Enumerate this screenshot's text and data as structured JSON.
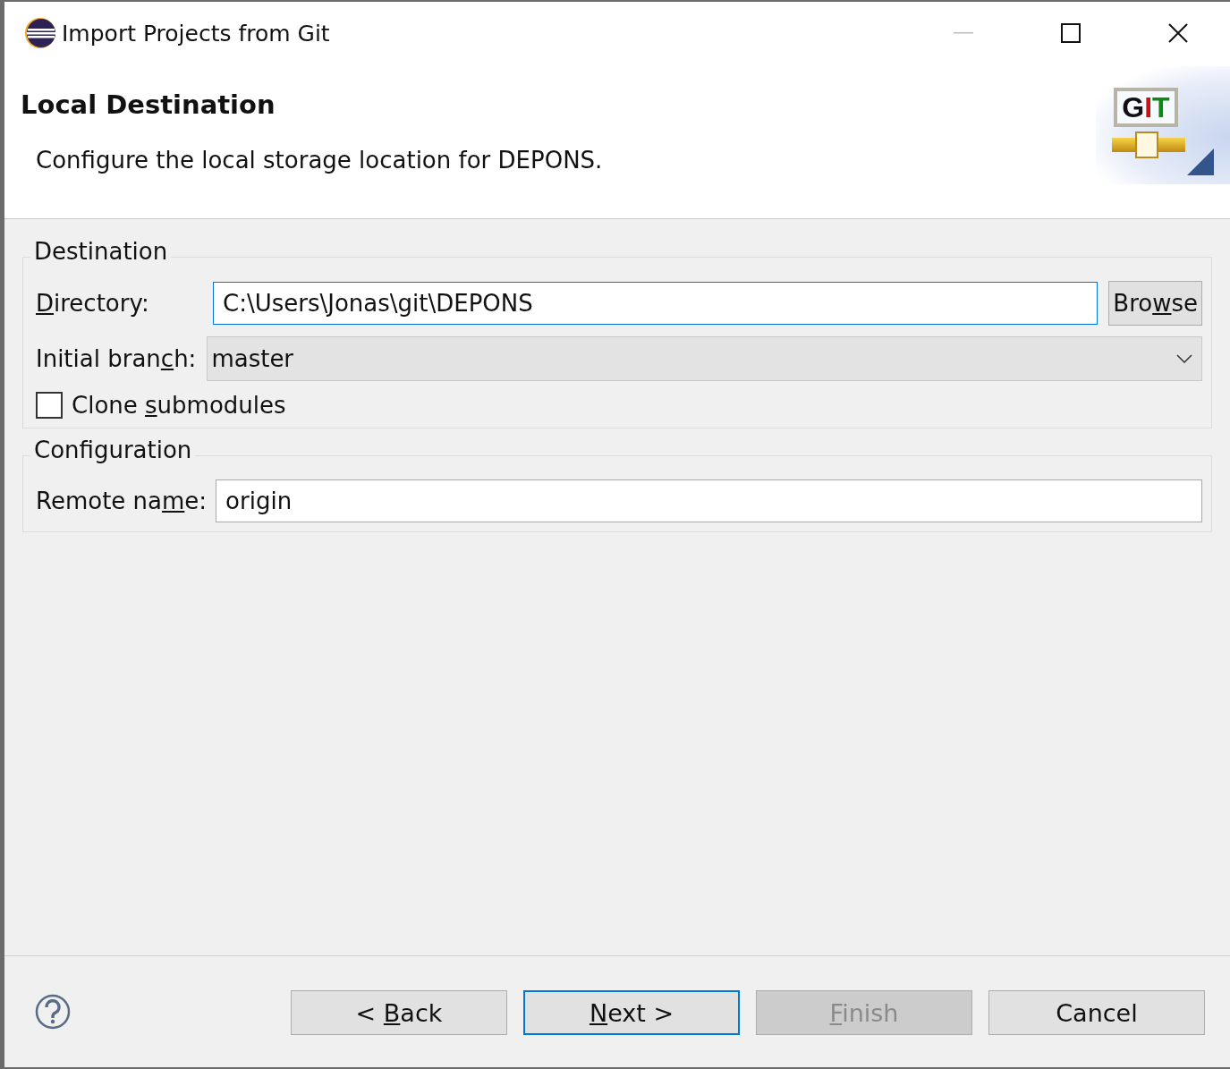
{
  "window": {
    "title": "Import Projects from Git"
  },
  "header": {
    "title": "Local Destination",
    "description": "Configure the local storage location for DEPONS.",
    "logo_letters": [
      {
        "text": "G",
        "color": "#111111"
      },
      {
        "text": "I",
        "color": "#cc1111"
      },
      {
        "text": "T",
        "color": "#118811"
      }
    ]
  },
  "destination": {
    "group_title": "Destination",
    "directory": {
      "label": [
        {
          "text": "D",
          "underlined": true
        },
        {
          "text": "irectory:",
          "underlined": false
        }
      ],
      "value": "C:\\Users\\Jonas\\git\\DEPONS",
      "focused": true
    },
    "browse": {
      "label": [
        {
          "text": "Bro",
          "underlined": false
        },
        {
          "text": "w",
          "underlined": true
        },
        {
          "text": "se",
          "underlined": false
        }
      ]
    },
    "initial_branch": {
      "label": [
        {
          "text": "Initial bran",
          "underlined": false
        },
        {
          "text": "c",
          "underlined": true
        },
        {
          "text": "h:",
          "underlined": false
        }
      ],
      "value": "master"
    },
    "clone_submodules": {
      "label": [
        {
          "text": "Clone ",
          "underlined": false
        },
        {
          "text": "s",
          "underlined": true
        },
        {
          "text": "ubmodules",
          "underlined": false
        }
      ],
      "checked": false
    }
  },
  "configuration": {
    "group_title": "Configuration",
    "remote_name": {
      "label": [
        {
          "text": "Remote na",
          "underlined": false
        },
        {
          "text": "m",
          "underlined": true
        },
        {
          "text": "e:",
          "underlined": false
        }
      ],
      "value": "origin"
    }
  },
  "buttons": [
    {
      "label": [
        {
          "text": "< ",
          "underlined": false
        },
        {
          "text": "B",
          "underlined": true
        },
        {
          "text": "ack",
          "underlined": false
        }
      ],
      "disabled": false,
      "default": false
    },
    {
      "label": [
        {
          "text": "N",
          "underlined": true
        },
        {
          "text": "ext >",
          "underlined": false
        }
      ],
      "disabled": false,
      "default": true
    },
    {
      "label": [
        {
          "text": "F",
          "underlined": true
        },
        {
          "text": "inish",
          "underlined": false
        }
      ],
      "disabled": true,
      "default": false
    },
    {
      "label": [
        {
          "text": "Cancel",
          "underlined": false
        }
      ],
      "disabled": false,
      "default": false
    }
  ]
}
